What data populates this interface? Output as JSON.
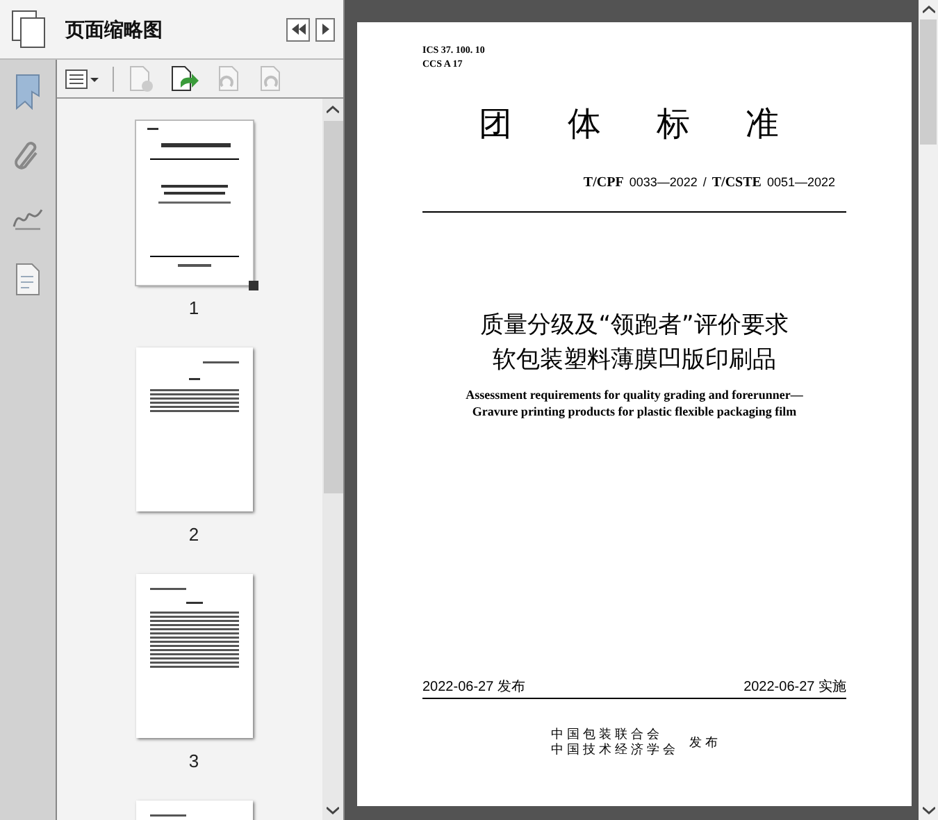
{
  "panel": {
    "title": "页面缩略图"
  },
  "thumbnails": [
    {
      "label": "1",
      "selected": true,
      "kind": "cover"
    },
    {
      "label": "2",
      "selected": false,
      "kind": "contents"
    },
    {
      "label": "3",
      "selected": false,
      "kind": "text"
    },
    {
      "selected": false,
      "kind": "text"
    }
  ],
  "document": {
    "ics": "ICS 37. 100. 10",
    "ccs": "CCS A 17",
    "heading": "团　体　标　准",
    "code_parts": [
      {
        "kind": "bold",
        "text": "T/CPF"
      },
      {
        "kind": "plain",
        "text": "0033—2022"
      },
      {
        "kind": "plain",
        "text": "/"
      },
      {
        "kind": "bold",
        "text": "T/CSTE"
      },
      {
        "kind": "plain",
        "text": "0051—2022"
      }
    ],
    "title_lines": [
      "质量分级及“领跑者”评价要求",
      "软包装塑料薄膜凹版印刷品"
    ],
    "english_lines": [
      "Assessment requirements for quality grading and forerunner—",
      "Gravure printing products for plastic flexible packaging film"
    ],
    "issue_date": "2022-06-27 发布",
    "implement_date": "2022-06-27 实施",
    "publishers": [
      "中 国 包 装 联 合 会",
      "中 国 技 术 经 济 学 会"
    ],
    "publish_word": "发 布"
  }
}
